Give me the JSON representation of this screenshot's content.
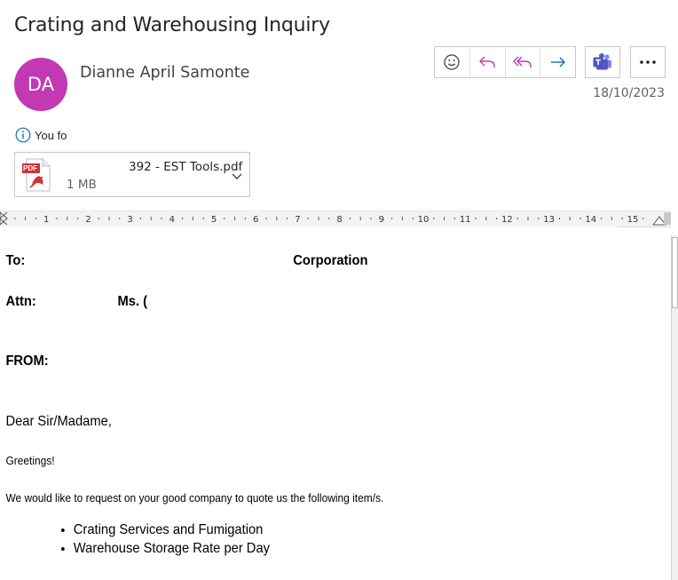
{
  "email": {
    "subject": "Crating and Warehousing Inquiry",
    "sender_initials": "DA",
    "sender_name": "Dianne April Samonte",
    "date": "18/10/2023",
    "info_text": "You fo",
    "colors": {
      "avatar": "#c239b3",
      "accent": "#5b5fc7",
      "teams": "#4b53bc"
    }
  },
  "actions": [
    {
      "name": "emoji-react-icon"
    },
    {
      "name": "reply-icon"
    },
    {
      "name": "reply-all-icon"
    },
    {
      "name": "forward-icon"
    }
  ],
  "attachment": {
    "filename": "392 - EST Tools.pdf",
    "size": "1 MB",
    "icon": "pdf-file-icon",
    "badge": "PDF"
  },
  "ruler": {
    "numbers": [
      "1",
      "2",
      "3",
      "4",
      "5",
      "6",
      "7",
      "8",
      "9",
      "10",
      "11",
      "12",
      "13",
      "14",
      "15"
    ]
  },
  "document": {
    "to_label": "To:",
    "to_value": "Corporation",
    "attn_label": "Attn:",
    "attn_value": "Ms. (",
    "from_label": "FROM:",
    "salutation": "Dear Sir/Madame,",
    "greeting": "Greetings!",
    "request": "We would like to request on your good company to quote us the following item/s.",
    "items": [
      "Crating Services and Fumigation",
      "Warehouse Storage Rate per Day"
    ]
  }
}
